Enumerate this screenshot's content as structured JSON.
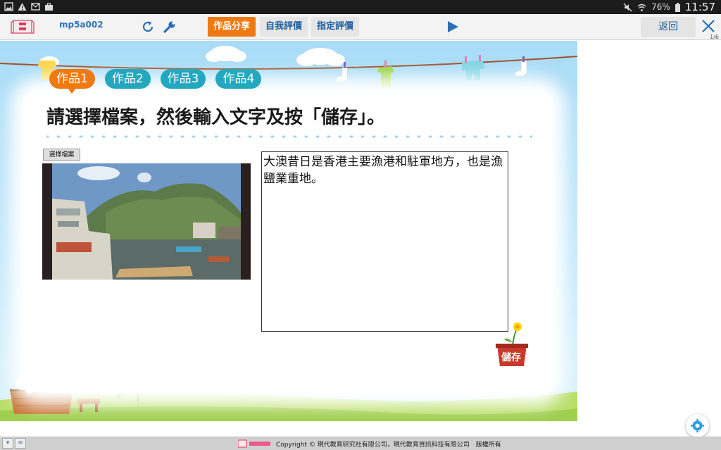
{
  "status_bar": {
    "battery": "76%",
    "time": "11:57"
  },
  "toolbar": {
    "book_id": "mp5a002",
    "tabs": [
      {
        "label": "作品分享",
        "active": true
      },
      {
        "label": "自我評價",
        "active": false
      },
      {
        "label": "指定評價",
        "active": false
      }
    ],
    "back_label": "返回",
    "page_count": "1/6"
  },
  "stage": {
    "work_tabs": [
      "作品1",
      "作品2",
      "作品3",
      "作品4"
    ],
    "active_work_tab": 0,
    "instruction": "請選擇檔案，然後輸入文字及按「儲存」。",
    "file_button_label": "選擇檔案",
    "text_value": "大澳昔日是香港主要漁港和駐軍地方，也是漁鹽業重地。",
    "save_label": "儲存"
  },
  "footer": {
    "copyright": "Copyright © 現代教育研究社有限公司，現代教育資訊科技有限公司　版權所有"
  },
  "colors": {
    "accent": "#f07a12",
    "teal": "#22a8bf",
    "link_blue": "#1f5fa0"
  }
}
